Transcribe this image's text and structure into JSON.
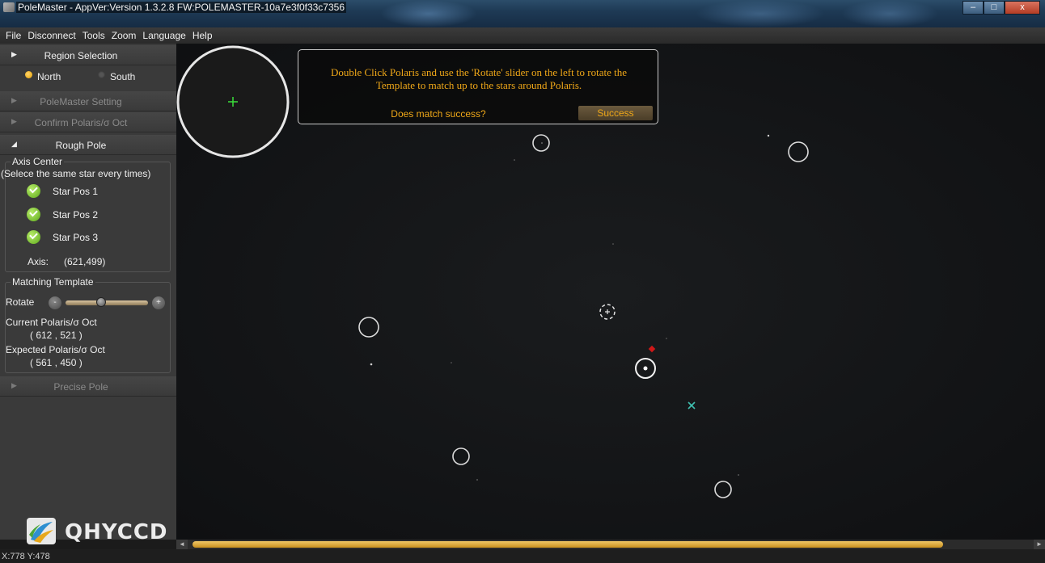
{
  "window": {
    "title": "PoleMaster - AppVer:Version 1.3.2.8 FW:POLEMASTER-10a7e3f0f33c7356",
    "minimize": "–",
    "maximize": "□",
    "close": "x"
  },
  "menu": [
    "File",
    "Disconnect",
    "Tools",
    "Zoom",
    "Language",
    "Help"
  ],
  "sidebar": {
    "region": {
      "label": "Region Selection",
      "north": "North",
      "south": "South",
      "selected": "North"
    },
    "polemaster_setting": "PoleMaster Setting",
    "confirm_polaris": "Confirm Polaris/σ Oct",
    "rough_pole": "Rough Pole",
    "axis_center": {
      "title": "Axis Center",
      "subtitle": "(Selece the same star every times)",
      "stars": [
        "Star Pos 1",
        "Star Pos 2",
        "Star Pos 3"
      ],
      "axis_label": "Axis:",
      "axis_value": "(621,499)"
    },
    "matching_template": {
      "title": "Matching Template",
      "rotate_label": "Rotate",
      "minus": "-",
      "plus": "+",
      "rotate_fraction": 0.42,
      "current_label": "Current Polaris/σ Oct",
      "current_value": "( 612 , 521 )",
      "expected_label": "Expected Polaris/σ Oct",
      "expected_value": "( 561 , 450 )"
    },
    "precise_pole": "Precise Pole",
    "logo_text": "QHYCCD"
  },
  "notice": {
    "message_line1": "Double Click Polaris and use the 'Rotate' slider on the left to rotate the",
    "message_line2": "Template to match up to the stars around Polaris.",
    "question": "Does match success?",
    "button": "Success"
  },
  "scrollbar": {
    "left": "◄",
    "right": "►",
    "position_fraction": 0.9
  },
  "status": {
    "coords": "X:778 Y:478"
  },
  "colors": {
    "accent": "#f0a818",
    "marker_red": "#d01818",
    "marker_cyan": "#3fbfb0",
    "crosshair_green": "#3adf3a"
  }
}
